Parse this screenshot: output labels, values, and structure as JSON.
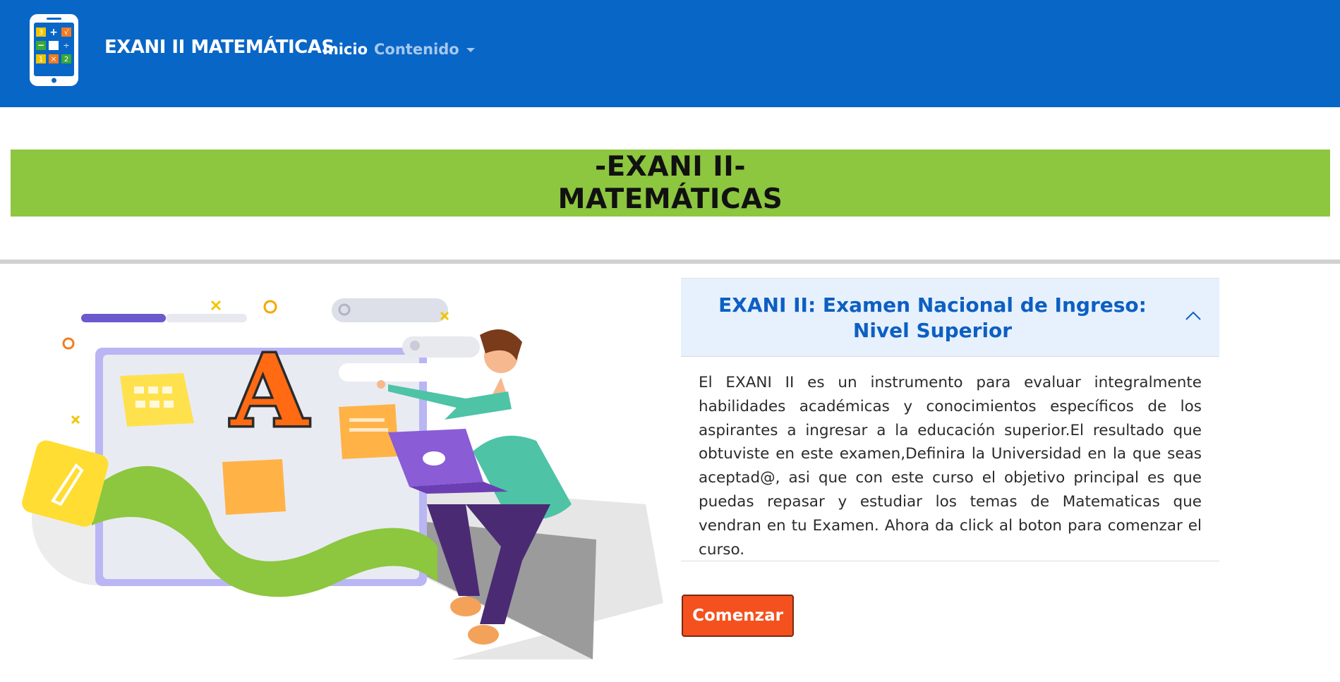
{
  "navbar": {
    "brand": "EXANI II MATEMÁTICAS",
    "links": [
      {
        "label": "Inicio"
      },
      {
        "label": "Contenido"
      }
    ],
    "logo_glyphs": [
      "3",
      "+",
      "√",
      "−",
      "÷",
      "1",
      "×",
      "2"
    ]
  },
  "banner": {
    "line1": "-EXANI II-",
    "line2": "MATEMÁTICAS"
  },
  "accordion": {
    "title": "EXANI II: Examen Nacional de Ingreso: Nivel Superior",
    "body": "El EXANI II es un instrumento para evaluar integralmente habilidades académicas y conocimientos específicos de los aspirantes a ingresar a la educación superior.El resultado que obtuviste en este examen,Definira la Universidad en la que seas aceptad@, asi que con este curso el objetivo principal es que puedas repasar y estudiar los temas de Matematicas que vendran en tu Examen. Ahora da click al boton para comenzar el curso.",
    "expanded": true
  },
  "cta": {
    "label": "Comenzar"
  },
  "illustration": {
    "letter": "A"
  },
  "colors": {
    "navbar": "#0866c6",
    "banner": "#8dc63f",
    "accent_title": "#0d5fc2",
    "button": "#f4511e"
  },
  "icons": [
    "calculator-phone-icon",
    "chevron-down-icon",
    "chevron-up-icon",
    "search-icon",
    "location-pin-icon",
    "rocket-icon",
    "laptop-icon"
  ]
}
